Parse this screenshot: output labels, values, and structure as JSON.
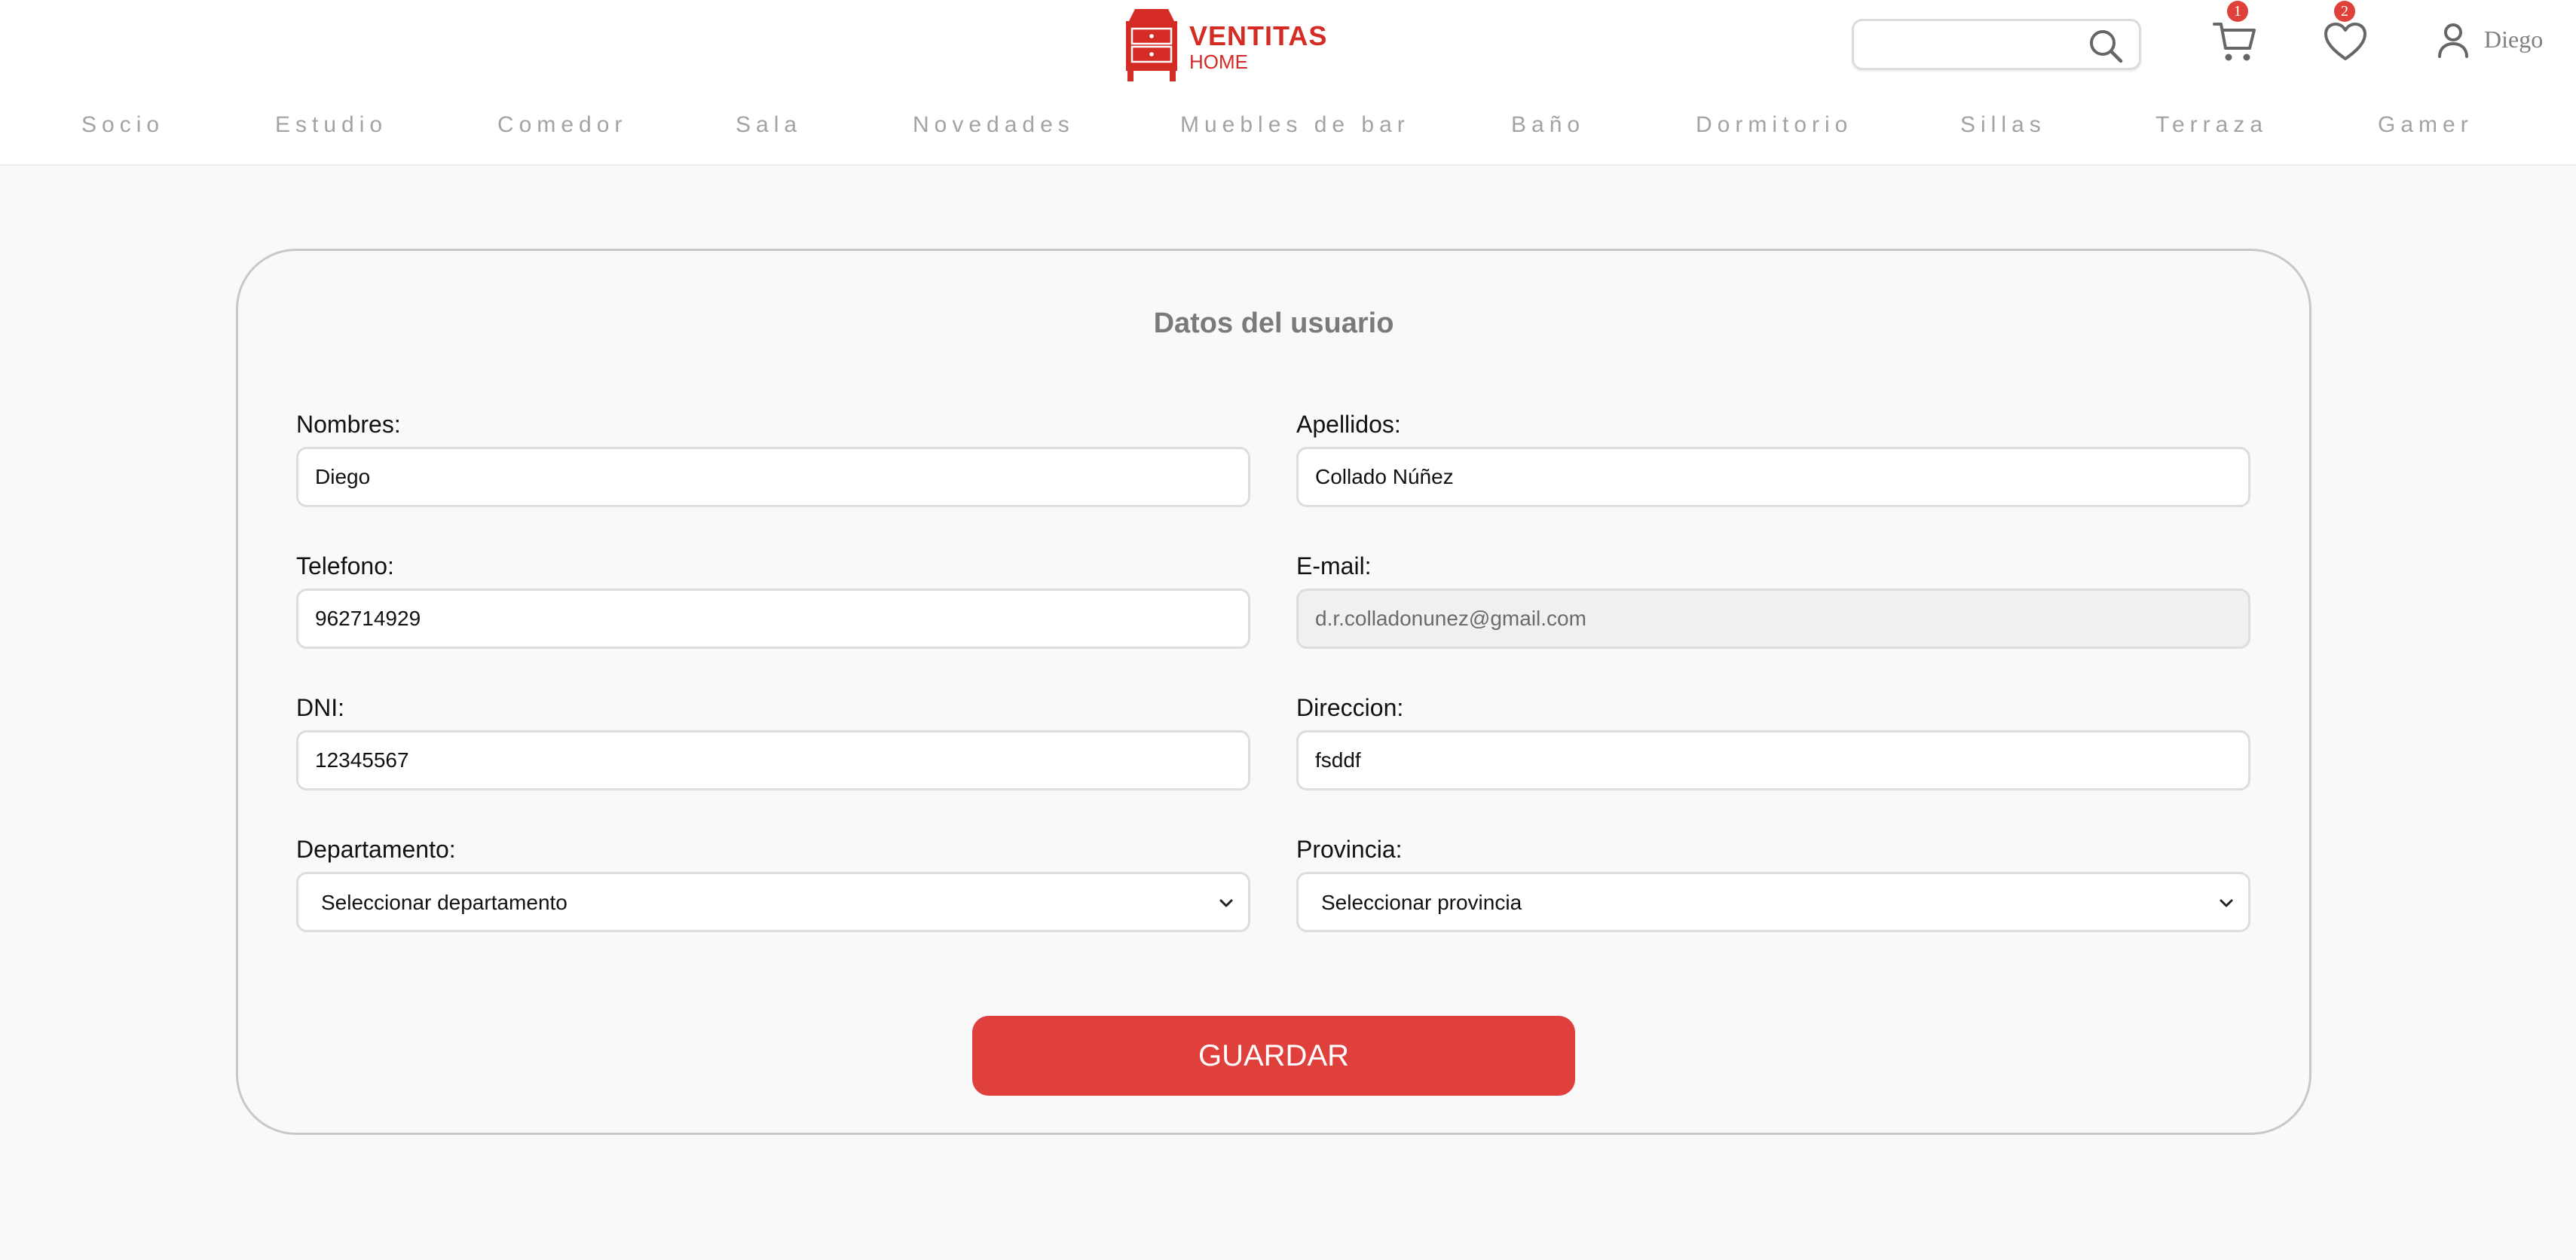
{
  "brand": {
    "name": "VENTITAS",
    "sub": "HOME",
    "color": "#d52b25"
  },
  "header": {
    "search_placeholder": "",
    "cart_count": "1",
    "wishlist_count": "2",
    "user_name": "Diego"
  },
  "nav": [
    "Socio",
    "Estudio",
    "Comedor",
    "Sala",
    "Novedades",
    "Muebles de bar",
    "Baño",
    "Dormitorio",
    "Sillas",
    "Terraza",
    "Gamer"
  ],
  "form": {
    "title": "Datos del usuario",
    "nombres": {
      "label": "Nombres:",
      "value": "Diego"
    },
    "apellidos": {
      "label": "Apellidos:",
      "value": "Collado Núñez"
    },
    "telefono": {
      "label": "Telefono:",
      "value": "962714929"
    },
    "email": {
      "label": "E-mail:",
      "value": "d.r.colladonunez@gmail.com",
      "disabled": true
    },
    "dni": {
      "label": "DNI:",
      "value": "12345567"
    },
    "direccion": {
      "label": "Direccion:",
      "value": "fsddf"
    },
    "departamento": {
      "label": "Departamento:",
      "selected": "Seleccionar departamento"
    },
    "provincia": {
      "label": "Provincia:",
      "selected": "Seleccionar provincia"
    },
    "save_label": "GUARDAR"
  },
  "colors": {
    "accent": "#e0403c",
    "badge": "#e0403a",
    "nav_text": "#a3a3a3"
  },
  "icons": [
    "dresser-logo-icon",
    "search-icon",
    "cart-icon",
    "heart-icon",
    "user-icon",
    "chevron-down-icon"
  ]
}
